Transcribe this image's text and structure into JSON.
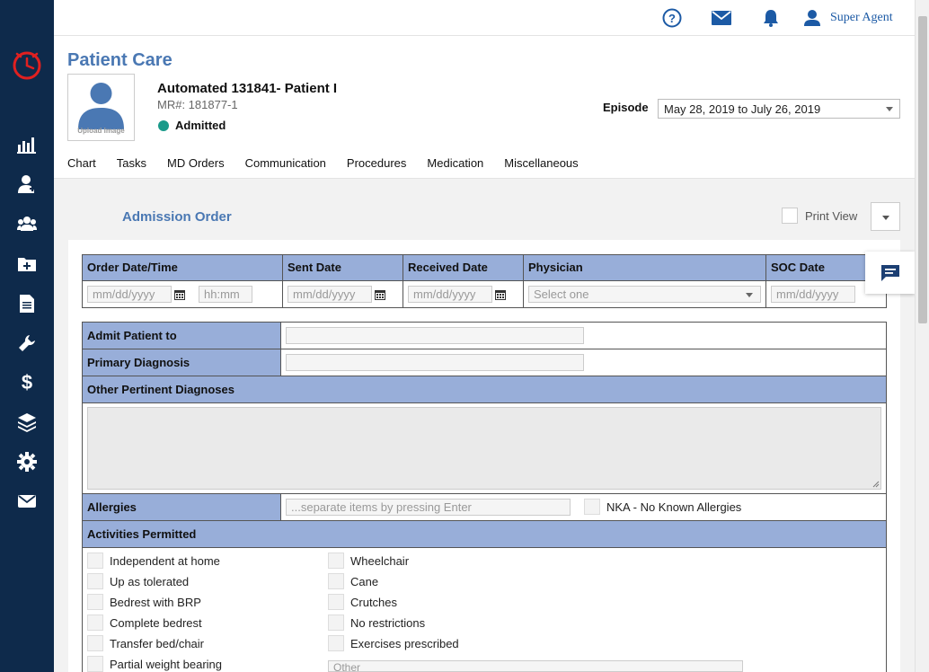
{
  "topbar": {
    "user_name": "Super Agent"
  },
  "patient": {
    "page_title": "Patient Care",
    "upload_label": "Upload Image",
    "name": "Automated 131841- Patient I",
    "mr": "MR#: 181877-1",
    "status": "Admitted",
    "episode_label": "Episode",
    "episode_value": "May 28, 2019 to July 26, 2019"
  },
  "tabs": [
    "Chart",
    "Tasks",
    "MD Orders",
    "Communication",
    "Procedures",
    "Medication",
    "Miscellaneous"
  ],
  "section": {
    "title": "Admission Order",
    "print_view": "Print View"
  },
  "order_table": {
    "headers": [
      "Order Date/Time",
      "Sent Date",
      "Received Date",
      "Physician",
      "SOC Date"
    ],
    "date_placeholder": "mm/dd/yyyy",
    "time_placeholder": "hh:mm",
    "physician_placeholder": "Select one"
  },
  "form": {
    "admit_patient_to": "Admit Patient to",
    "primary_diagnosis": "Primary Diagnosis",
    "other_pertinent": "Other Pertinent Diagnoses",
    "allergies": "Allergies",
    "allergies_placeholder": "...separate items by pressing Enter",
    "nka": "NKA - No Known Allergies",
    "activities": "Activities Permitted",
    "other_placeholder": "Other"
  },
  "activities_left": [
    "Independent at home",
    "Up as tolerated",
    "Bedrest with BRP",
    "Complete bedrest",
    "Transfer bed/chair",
    "Partial weight bearing"
  ],
  "activities_right": [
    "Wheelchair",
    "Cane",
    "Crutches",
    "No restrictions",
    "Exercises prescribed"
  ],
  "colors": {
    "sidebar": "#0e2a4b",
    "accent": "#4a78b3",
    "table_header": "#98aed9",
    "status_admitted": "#1a9a8a",
    "logo_red": "#e02020"
  }
}
